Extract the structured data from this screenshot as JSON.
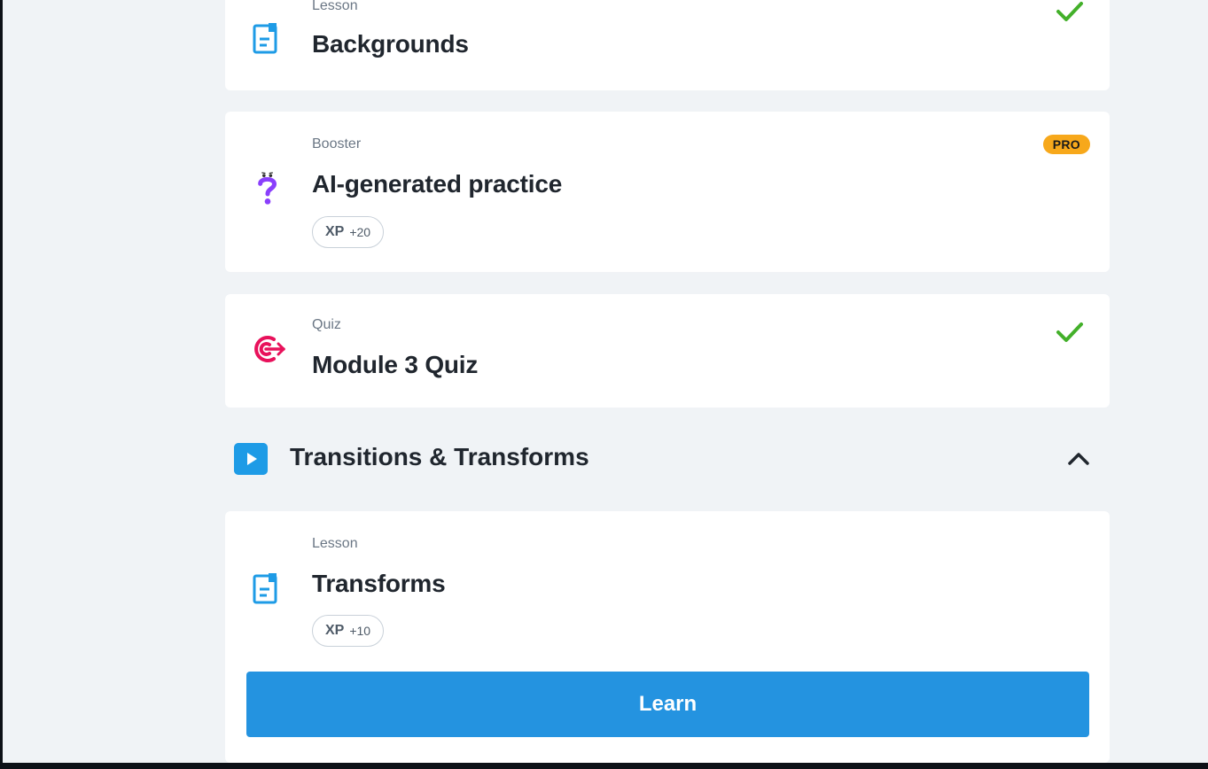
{
  "items": [
    {
      "type": "Lesson",
      "title": "Backgrounds",
      "icon": "lesson-document-icon",
      "completed": true
    },
    {
      "type": "Booster",
      "title": "AI-generated practice",
      "icon": "question-mark-character-icon",
      "badge": "PRO",
      "xp_label": "XP",
      "xp_value": "+20"
    },
    {
      "type": "Quiz",
      "title": "Module 3 Quiz",
      "icon": "target-icon",
      "completed": true
    }
  ],
  "section": {
    "title": "Transitions & Transforms",
    "icon": "play-icon",
    "collapse_icon": "chevron-up-icon",
    "items": [
      {
        "type": "Lesson",
        "title": "Transforms",
        "icon": "lesson-document-icon",
        "xp_label": "XP",
        "xp_value": "+10",
        "button_label": "Learn"
      }
    ]
  },
  "colors": {
    "accent_blue": "#2493e0",
    "check_green": "#43b02a",
    "pro_orange": "#f7a81b",
    "quiz_pink": "#e8115b",
    "booster_purple": "#8a3ffc"
  }
}
